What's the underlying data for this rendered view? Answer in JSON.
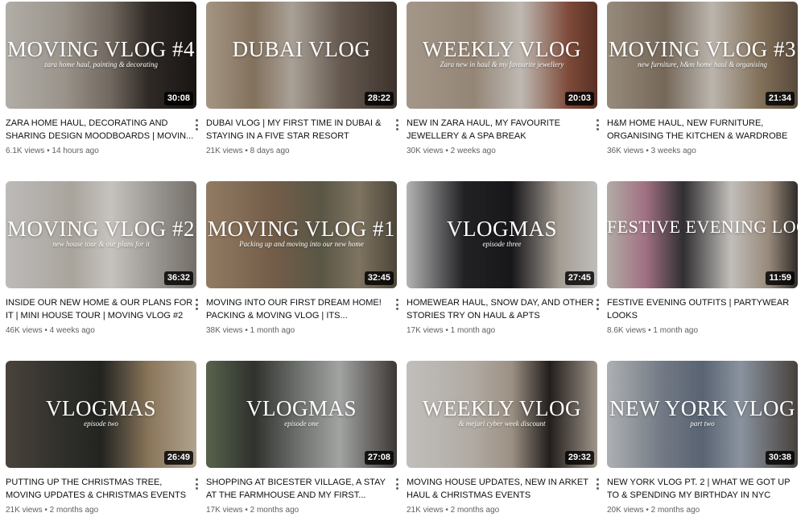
{
  "videos": [
    {
      "title": "ZARA HOME HAUL, DECORATING AND SHARING DESIGN MOODBOARDS | MOVIN...",
      "views": "6.1K views",
      "age": "14 hours ago",
      "duration": "30:08",
      "thumb_title": "MOVING VLOG #4",
      "thumb_sub": "zara home haul, painting & decorating",
      "bg": "linear-gradient(90deg,#d8d3cc 0%,#bdb5ab 30%,#8a7f74 55%,#3a332e 75%,#1e1a18 100%)"
    },
    {
      "title": "DUBAI VLOG | MY FIRST TIME IN DUBAI & STAYING IN A FIVE STAR RESORT",
      "views": "21K views",
      "age": "8 days ago",
      "duration": "28:22",
      "thumb_title": "DUBAI VLOG",
      "thumb_sub": "",
      "bg": "linear-gradient(90deg,#c9b7a0 0%,#a08a72 25%,#cfc5b8 45%,#7e6f62 70%,#4a3f37 100%)"
    },
    {
      "title": "NEW IN ZARA HAUL, MY FAVOURITE JEWELLERY & A SPA BREAK",
      "views": "30K views",
      "age": "2 weeks ago",
      "duration": "20:03",
      "thumb_title": "WEEKLY VLOG",
      "thumb_sub": "Zara new in haul & my favourite jewellery",
      "bg": "linear-gradient(90deg,#c8b9a8 0%,#b5a390 35%,#e8e2da 60%,#9a5a45 85%,#6d3c2c 100%)"
    },
    {
      "title": "H&M HOME HAUL, NEW FURNITURE, ORGANISING THE KITCHEN & WARDROBE |...",
      "views": "36K views",
      "age": "3 weeks ago",
      "duration": "21:34",
      "thumb_title": "MOVING VLOG #3",
      "thumb_sub": "new furniture, h&m home haul & organising",
      "bg": "linear-gradient(90deg,#b9aa98 0%,#8f7f6d 30%,#e4ddd3 55%,#a08a6e 80%,#6b5a48 100%)"
    },
    {
      "title": "INSIDE OUR NEW HOME & OUR PLANS FOR IT | MINI HOUSE TOUR | MOVING VLOG #2",
      "views": "46K views",
      "age": "4 weeks ago",
      "duration": "36:32",
      "thumb_title": "MOVING VLOG #2",
      "thumb_sub": "new house tour & our plans for it",
      "bg": "linear-gradient(90deg,#e6e4e1 0%,#cfc8bf 35%,#f2eee9 55%,#b8b3ad 80%,#8d8780 100%)"
    },
    {
      "title": "MOVING INTO OUR FIRST DREAM HOME! PACKING & MOVING VLOG | ITS...",
      "views": "38K views",
      "age": "1 month ago",
      "duration": "32:45",
      "thumb_title": "MOVING VLOG #1",
      "thumb_sub": "Packing up and moving into our new home",
      "bg": "linear-gradient(90deg,#b3977a 0%,#8d7259 35%,#6e6a55 60%,#9b8d77 80%,#5d5646 100%)"
    },
    {
      "title": "HOMEWEAR HAUL, SNOW DAY, AND OTHER STORIES TRY ON HAUL & APTS",
      "views": "17K views",
      "age": "1 month ago",
      "duration": "27:45",
      "thumb_title": "VLOGMAS",
      "thumb_sub": "episode three",
      "bg": "linear-gradient(90deg,#dcdcdc 0%,#2a2a2d 30%,#1d1c20 55%,#c9bfb4 80%,#e9e7e5 100%)"
    },
    {
      "title": "FESTIVE EVENING OUTFITS | PARTYWEAR LOOKS",
      "views": "8.6K views",
      "age": "1 month ago",
      "duration": "11:59",
      "thumb_title": "FESTIVE EVENING LOOKS",
      "thumb_sub": "",
      "bg": "linear-gradient(90deg,#d9d2c9 0%,#c58aa0 20%,#3c3a3d 40%,#ece8e3 65%,#b9a794 85%,#3a3432 100%)"
    },
    {
      "title": "PUTTING UP THE CHRISTMAS TREE, MOVING UPDATES & CHRISTMAS EVENTS",
      "views": "21K views",
      "age": "2 months ago",
      "duration": "26:49",
      "thumb_title": "VLOGMAS",
      "thumb_sub": "episode two",
      "bg": "linear-gradient(90deg,#5a524a 0%,#3b3a34 30%,#2a2c28 50%,#a8906f 75%,#d8c7ad 100%)"
    },
    {
      "title": "SHOPPING AT BICESTER VILLAGE, A STAY AT THE FARMHOUSE AND MY FIRST...",
      "views": "17K views",
      "age": "2 months ago",
      "duration": "27:08",
      "thumb_title": "VLOGMAS",
      "thumb_sub": "episode one",
      "bg": "linear-gradient(90deg,#6c7a5e 0%,#3a3d38 25%,#8b8f8a 50%,#c5c8c6 70%,#4b4441 100%)"
    },
    {
      "title": "MOVING HOUSE UPDATES, NEW IN ARKET HAUL & CHRISTMAS EVENTS",
      "views": "21K views",
      "age": "2 months ago",
      "duration": "29:32",
      "thumb_title": "WEEKLY VLOG",
      "thumb_sub": "& mejuri cyber week discount",
      "bg": "linear-gradient(90deg,#ece9e5 0%,#d7d0c7 35%,#bfb1a1 55%,#2a2523 75%,#c3b7a9 100%)"
    },
    {
      "title": "NEW YORK VLOG PT. 2 | WHAT WE GOT UP TO & SPENDING MY BIRTHDAY IN NYC",
      "views": "20K views",
      "age": "2 months ago",
      "duration": "30:38",
      "thumb_title": "NEW YORK VLOG",
      "thumb_sub": "part two",
      "bg": "linear-gradient(90deg,#d4d7da 0%,#8a93a0 30%,#6d7a8c 50%,#a9b4c2 70%,#57504a 100%)"
    }
  ]
}
